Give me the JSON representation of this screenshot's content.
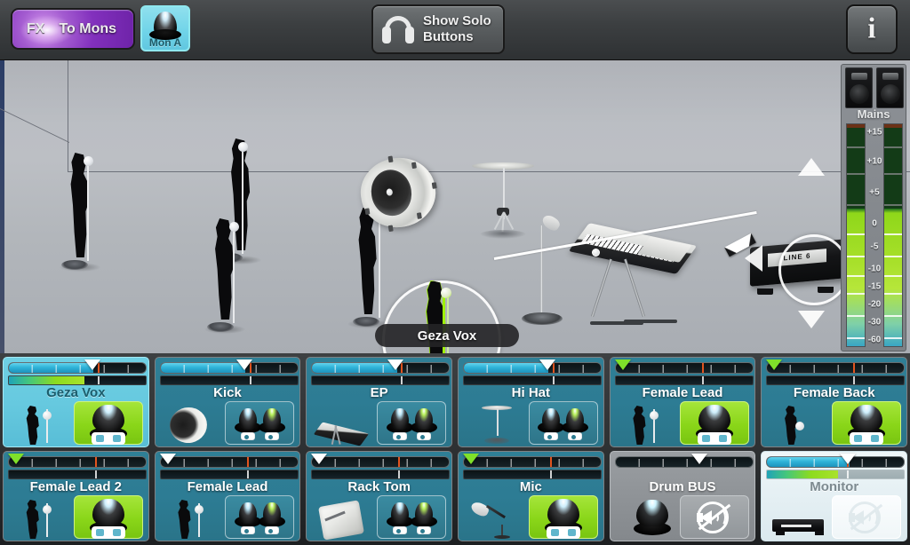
{
  "toolbar": {
    "fx_label": "FX",
    "to_mons_label": "To Mons",
    "mon_button_label": "Mon A",
    "mon_icon": "knob-icon",
    "solo_label_line1": "Show Solo",
    "solo_label_line2": "Buttons",
    "solo_icon": "headphones-icon",
    "info_label": "i",
    "info_icon": "info-icon"
  },
  "stage": {
    "selected_performer": "Geza Vox",
    "selected_device_label": "LINE 6",
    "accent_select_color": "#9ef20a",
    "ring_color": "#ffffff",
    "floor_color": "#b7babf"
  },
  "mains": {
    "label": "Mains",
    "scale": [
      "+15",
      "+10",
      "+5",
      "0",
      "-5",
      "-10",
      "-15",
      "-20",
      "-30",
      "-60"
    ],
    "left_level": 62,
    "right_level": 62,
    "speaker_icon": "speaker-cabinet-icon"
  },
  "strips": [
    {
      "name": "Geza Vox",
      "fader": 62,
      "meter": 55,
      "unity": 64,
      "state": "selected",
      "thumb": "singer-photo",
      "control": "big-knob-green",
      "handle": "white"
    },
    {
      "name": "Kick",
      "fader": 62,
      "meter": 0,
      "unity": 64,
      "state": "normal",
      "thumb": "kick-drum-photo",
      "control": "dual-knob",
      "handle": "white"
    },
    {
      "name": "EP",
      "fader": 62,
      "meter": 0,
      "unity": 64,
      "state": "normal",
      "thumb": "keyboard-photo",
      "control": "dual-knob",
      "handle": "white"
    },
    {
      "name": "Hi Hat",
      "fader": 62,
      "meter": 0,
      "unity": 64,
      "state": "normal",
      "thumb": "hihat-photo",
      "control": "dual-knob",
      "handle": "white"
    },
    {
      "name": "Female Lead",
      "fader": 0,
      "meter": 0,
      "unity": 62,
      "state": "normal",
      "thumb": "singer-photo",
      "control": "big-knob-green",
      "handle": "green"
    },
    {
      "name": "Female Back",
      "fader": 0,
      "meter": 0,
      "unity": 62,
      "state": "normal",
      "thumb": "backing-singer-photo",
      "control": "big-knob-green",
      "handle": "green"
    },
    {
      "name": "Female Lead 2",
      "fader": 0,
      "meter": 0,
      "unity": 62,
      "state": "normal",
      "thumb": "singer-photo",
      "control": "big-knob-green",
      "handle": "green"
    },
    {
      "name": "Female Lead",
      "fader": 0,
      "meter": 0,
      "unity": 62,
      "state": "normal",
      "thumb": "singer-photo",
      "control": "dual-knob",
      "handle": "white"
    },
    {
      "name": "Rack Tom",
      "fader": 0,
      "meter": 0,
      "unity": 62,
      "state": "normal",
      "thumb": "rack-tom-photo",
      "control": "dual-knob",
      "handle": "white"
    },
    {
      "name": "Mic",
      "fader": 0,
      "meter": 0,
      "unity": 62,
      "state": "normal",
      "thumb": "handheld-mic-photo",
      "control": "big-knob-green",
      "handle": "green"
    },
    {
      "name": "Drum BUS",
      "fader": 62,
      "meter": 0,
      "unity": 0,
      "state": "bus",
      "thumb": "bus-knob",
      "control": "speaker-mute",
      "handle": "white"
    },
    {
      "name": "Monitor",
      "fader": 60,
      "meter": 52,
      "unity": 58,
      "state": "monitor",
      "thumb": "amp-photo",
      "control": "speaker-mute-faded",
      "handle": "white"
    }
  ]
}
